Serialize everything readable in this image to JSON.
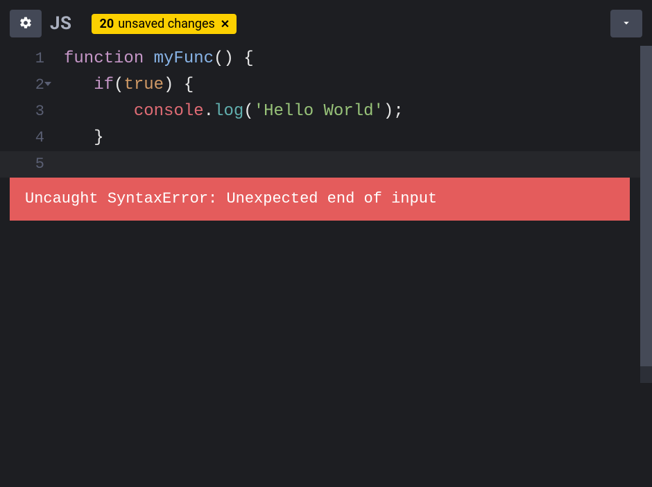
{
  "toolbar": {
    "language_label": "JS",
    "unsaved": {
      "count": "20",
      "text": "unsaved changes"
    }
  },
  "code": {
    "lines": [
      {
        "n": "1",
        "current": false,
        "fold": false,
        "tokens": [
          {
            "cls": "tok-keyword",
            "t": "function"
          },
          {
            "cls": "tok-default",
            "t": " "
          },
          {
            "cls": "tok-funcname",
            "t": "myFunc"
          },
          {
            "cls": "tok-paren",
            "t": "()"
          },
          {
            "cls": "tok-default",
            "t": " "
          },
          {
            "cls": "tok-brace",
            "t": "{"
          }
        ]
      },
      {
        "n": "2",
        "current": false,
        "fold": true,
        "tokens": [
          {
            "cls": "tok-default",
            "t": "   "
          },
          {
            "cls": "tok-keyword",
            "t": "if"
          },
          {
            "cls": "tok-paren",
            "t": "("
          },
          {
            "cls": "tok-bool",
            "t": "true"
          },
          {
            "cls": "tok-paren",
            "t": ")"
          },
          {
            "cls": "tok-default",
            "t": " "
          },
          {
            "cls": "tok-brace",
            "t": "{"
          }
        ]
      },
      {
        "n": "3",
        "current": false,
        "fold": false,
        "tokens": [
          {
            "cls": "tok-default",
            "t": "       "
          },
          {
            "cls": "tok-ident",
            "t": "console"
          },
          {
            "cls": "tok-dot",
            "t": "."
          },
          {
            "cls": "tok-method",
            "t": "log"
          },
          {
            "cls": "tok-paren",
            "t": "("
          },
          {
            "cls": "tok-string",
            "t": "'Hello World'"
          },
          {
            "cls": "tok-paren",
            "t": ")"
          },
          {
            "cls": "tok-semi",
            "t": ";"
          }
        ]
      },
      {
        "n": "4",
        "current": false,
        "fold": false,
        "tokens": [
          {
            "cls": "tok-default",
            "t": "   "
          },
          {
            "cls": "tok-brace",
            "t": "}"
          }
        ]
      },
      {
        "n": "5",
        "current": true,
        "fold": false,
        "tokens": []
      }
    ]
  },
  "error": {
    "message": "Uncaught SyntaxError: Unexpected end of input"
  }
}
